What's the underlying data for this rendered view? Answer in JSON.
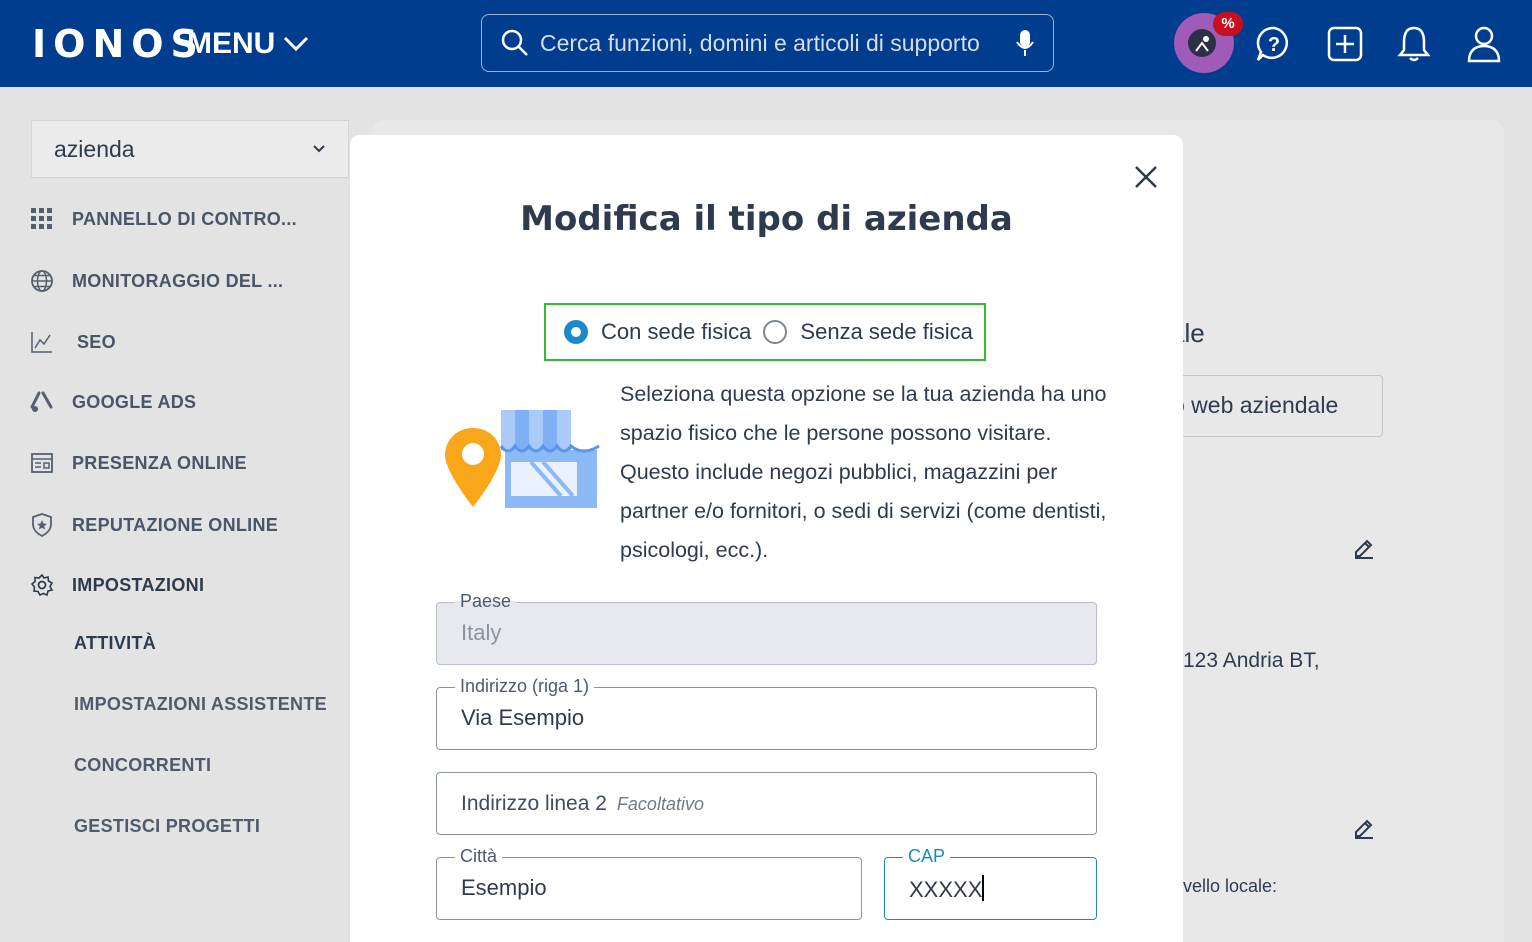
{
  "header": {
    "logo": "IONOS",
    "menu_label": "MENU",
    "search_placeholder": "Cerca funzioni, domini e articoli di supporto",
    "promo_badge": "%"
  },
  "sidebar": {
    "selector_value": "azienda",
    "items": [
      {
        "label": "PANNELLO DI CONTRO...",
        "icon": "grid-icon"
      },
      {
        "label": "MONITORAGGIO DEL ...",
        "icon": "globe-icon"
      },
      {
        "label": "SEO",
        "icon": "chart-icon"
      },
      {
        "label": "GOOGLE ADS",
        "icon": "google-ads-icon"
      },
      {
        "label": "PRESENZA ONLINE",
        "icon": "listing-icon"
      },
      {
        "label": "REPUTAZIONE ONLINE",
        "icon": "shield-star-icon"
      },
      {
        "label": "IMPOSTAZIONI",
        "icon": "gear-icon"
      }
    ],
    "subitems": [
      "ATTIVITÀ",
      "IMPOSTAZIONI ASSISTENTE",
      "CONCORRENTI",
      "GESTISCI PROGETTI"
    ]
  },
  "background": {
    "heading_fragment": "ale",
    "button_fragment": "o web aziendale",
    "address_fragment": "123 Andria BT,",
    "local_fragment": "vello locale:"
  },
  "modal": {
    "title": "Modifica il tipo di azienda",
    "options": [
      {
        "label": "Con sede fisica",
        "checked": true
      },
      {
        "label": "Senza sede fisica",
        "checked": false
      }
    ],
    "description": "Seleziona questa opzione se la tua azienda ha uno spazio fisico che le persone possono visitare. Questo include negozi pubblici, magazzini per partner e/o fornitori, o sedi di servizi (come dentisti, psicologi, ecc.).",
    "fields": {
      "country": {
        "label": "Paese",
        "value": "Italy"
      },
      "address1": {
        "label": "Indirizzo (riga 1)",
        "value": "Via Esempio"
      },
      "address2": {
        "placeholder": "Indirizzo linea 2",
        "optional": "Facoltativo"
      },
      "city": {
        "label": "Città",
        "value": "Esempio"
      },
      "zip": {
        "label": "CAP",
        "value": "XXXXX"
      }
    }
  },
  "colors": {
    "header_bg": "#003d8f",
    "accent": "#1d88c9",
    "highlight": "#2fbe2f"
  }
}
